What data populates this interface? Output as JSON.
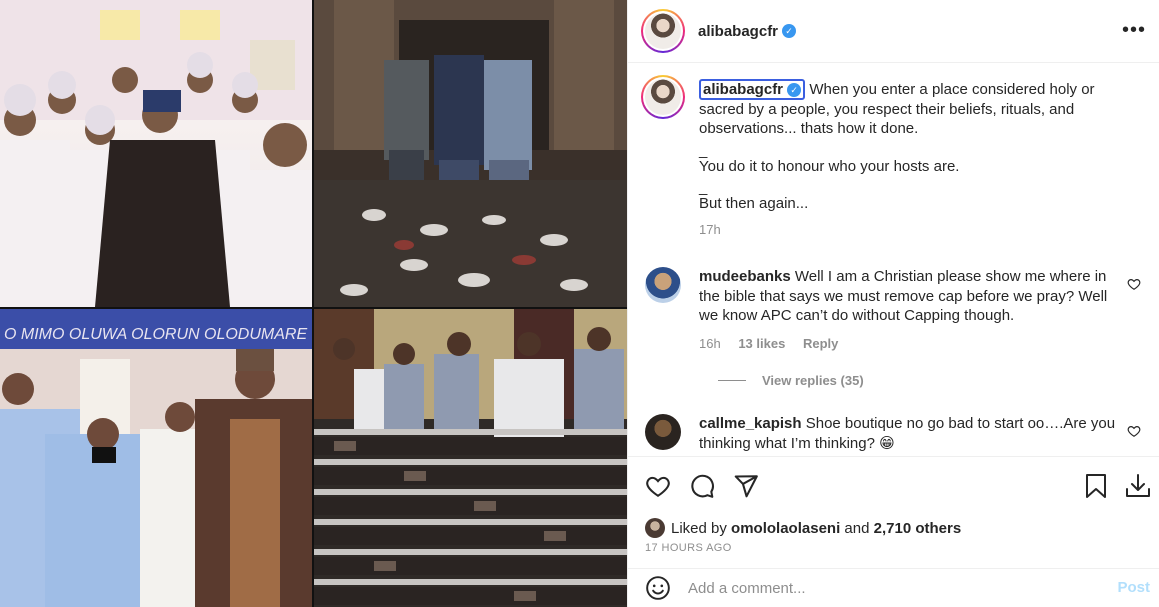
{
  "post": {
    "username": "alibabagcfr",
    "verified_icon": "verified-badge-icon",
    "more_icon": "more-options-icon"
  },
  "caption": {
    "username": "alibabagcfr",
    "para1": "When you enter a place considered holy or sacred by a people, you respect their beliefs, rituals, and observations... thats how it done.",
    "sep1": "_",
    "para2": "You do it to honour who your hosts are.",
    "sep2": "_",
    "para3": "But then again...",
    "time": "17h"
  },
  "comments": [
    {
      "username": "mudeebanks",
      "text": "Well I am a Christian please show me where in the bible that says we must remove cap before we pray? Well we know APC can’t do without Capping though.",
      "time": "16h",
      "likes": "13 likes",
      "reply": "Reply",
      "view_replies": "View replies (35)"
    },
    {
      "username": "callme_kapish",
      "text": "Shoe boutique no go bad to start oo….Are you thinking what I’m thinking? 😁"
    }
  ],
  "likes": {
    "prefix": "Liked by",
    "user": "omololaolaseni",
    "conj": "and",
    "others": "2,710 others",
    "ago": "17 HOURS AGO"
  },
  "composer": {
    "placeholder": "Add a comment...",
    "post_label": "Post"
  },
  "colors": {
    "link_blue": "#3897f0",
    "post_disabled": "#b2dffc",
    "muted": "#8e8e8e"
  }
}
